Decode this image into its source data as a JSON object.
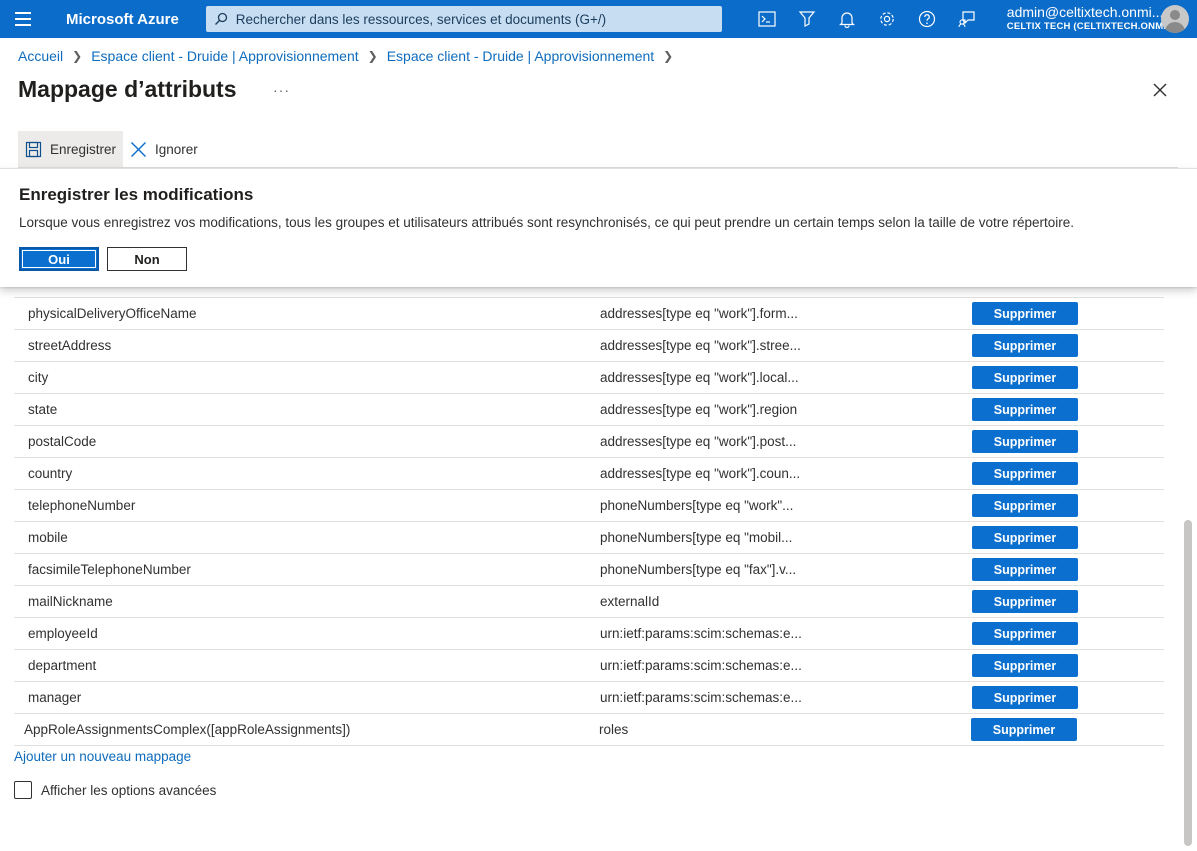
{
  "topbar": {
    "brand": "Microsoft Azure",
    "search_placeholder": "Rechercher dans les ressources, services et documents (G+/)",
    "account_email": "admin@celtixtech.onmi...",
    "account_tenant": "CELTIX TECH (CELTIXTECH.ONM..."
  },
  "breadcrumb": [
    "Accueil",
    "Espace client - Druide | Approvisionnement",
    "Espace client - Druide | Approvisionnement"
  ],
  "page": {
    "title": "Mappage d’attributs",
    "more": "···"
  },
  "toolbar": {
    "save_label": "Enregistrer",
    "discard_label": "Ignorer"
  },
  "dialog": {
    "title": "Enregistrer les modifications",
    "message": "Lorsque vous enregistrez vos modifications, tous les groupes et utilisateurs attribués sont resynchronisés, ce qui peut prendre un certain temps selon la taille de votre répertoire.",
    "yes_label": "Oui",
    "no_label": "Non"
  },
  "mappings": {
    "delete_label": "Supprimer",
    "rows": [
      {
        "source": "physicalDeliveryOfficeName",
        "target": "addresses[type eq \"work\"].form..."
      },
      {
        "source": "streetAddress",
        "target": "addresses[type eq \"work\"].stree..."
      },
      {
        "source": "city",
        "target": "addresses[type eq \"work\"].local..."
      },
      {
        "source": "state",
        "target": "addresses[type eq \"work\"].region"
      },
      {
        "source": "postalCode",
        "target": "addresses[type eq \"work\"].post..."
      },
      {
        "source": "country",
        "target": "addresses[type eq \"work\"].coun..."
      },
      {
        "source": "telephoneNumber",
        "target": "phoneNumbers[type eq \"work\"..."
      },
      {
        "source": "mobile",
        "target": "phoneNumbers[type eq \"mobil..."
      },
      {
        "source": "facsimileTelephoneNumber",
        "target": "phoneNumbers[type eq \"fax\"].v..."
      },
      {
        "source": "mailNickname",
        "target": "externalId"
      },
      {
        "source": "employeeId",
        "target": "urn:ietf:params:scim:schemas:e..."
      },
      {
        "source": "department",
        "target": "urn:ietf:params:scim:schemas:e..."
      },
      {
        "source": "manager",
        "target": "urn:ietf:params:scim:schemas:e..."
      },
      {
        "source": "AppRoleAssignmentsComplex([appRoleAssignments])",
        "target": "roles"
      }
    ],
    "add_label": "Ajouter un nouveau mappage",
    "advanced_label": "Afficher les options avancées"
  }
}
